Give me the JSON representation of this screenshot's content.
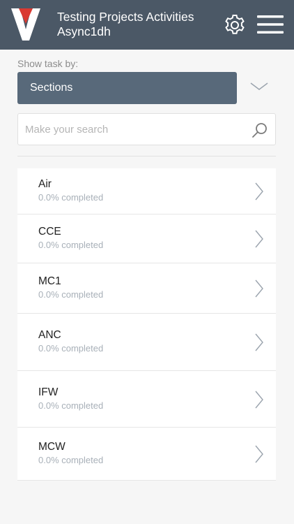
{
  "header": {
    "title_line1": "Testing Projects Activities",
    "title_line2": "Async1dh",
    "logo_icon": "v-logo-icon",
    "settings_icon": "gear-icon",
    "menu_icon": "hamburger-menu-icon",
    "colors": {
      "bar": "#4b5866",
      "logo_accent": "#d93a32"
    }
  },
  "filter": {
    "label": "Show task by:",
    "selected": "Sections",
    "dropdown_icon": "chevron-down-icon"
  },
  "search": {
    "placeholder": "Make your search",
    "icon": "search-icon"
  },
  "sections": [
    {
      "name": "Air",
      "progress": "0.0% completed"
    },
    {
      "name": "CCE",
      "progress": "0.0% completed"
    },
    {
      "name": "MC1",
      "progress": "0.0% completed"
    },
    {
      "name": "ANC",
      "progress": "0.0% completed"
    },
    {
      "name": "IFW",
      "progress": "0.0% completed"
    },
    {
      "name": "MCW",
      "progress": "0.0% completed"
    }
  ]
}
